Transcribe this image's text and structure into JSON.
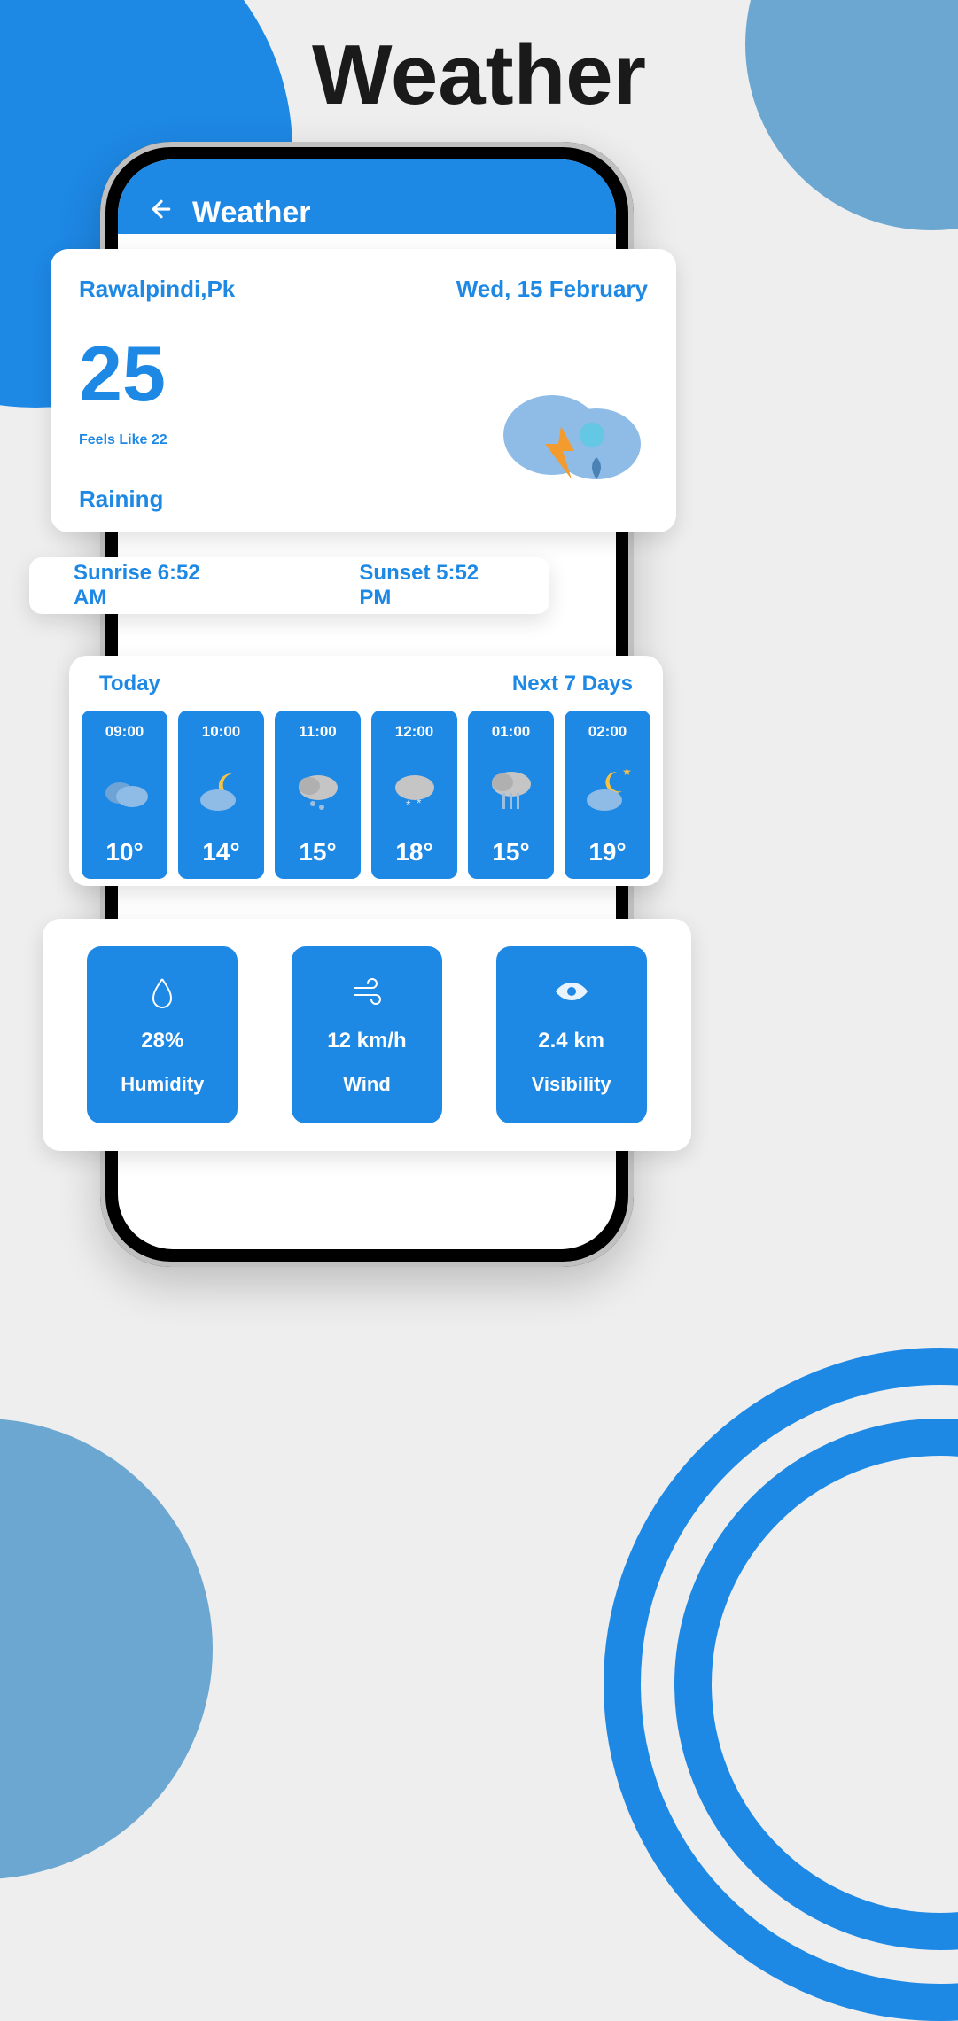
{
  "page_title": "Weather",
  "app_bar": {
    "title": "Weather"
  },
  "main_card": {
    "location": "Rawalpindi,Pk",
    "date": "Wed, 15 February",
    "temp": "25",
    "feels_like": "Feels Like 22",
    "condition": "Raining"
  },
  "sun": {
    "sunrise": "Sunrise 6:52 AM",
    "sunset": "Sunset 5:52 PM"
  },
  "hourly": {
    "today_label": "Today",
    "next7_label": "Next 7 Days",
    "cells": [
      {
        "time": "09:00",
        "temp": "10°",
        "icon": "cloud"
      },
      {
        "time": "10:00",
        "temp": "14°",
        "icon": "moon-cloud"
      },
      {
        "time": "11:00",
        "temp": "15°",
        "icon": "rain-drizzle"
      },
      {
        "time": "12:00",
        "temp": "18°",
        "icon": "snow"
      },
      {
        "time": "01:00",
        "temp": "15°",
        "icon": "heavy-rain"
      },
      {
        "time": "02:00",
        "temp": "19°",
        "icon": "moon-cloud-star"
      }
    ]
  },
  "stats": {
    "humidity": {
      "value": "28%",
      "label": "Humidity"
    },
    "wind": {
      "value": "12 km/h",
      "label": "Wind"
    },
    "visibility": {
      "value": "2.4 km",
      "label": "Visibility"
    }
  }
}
